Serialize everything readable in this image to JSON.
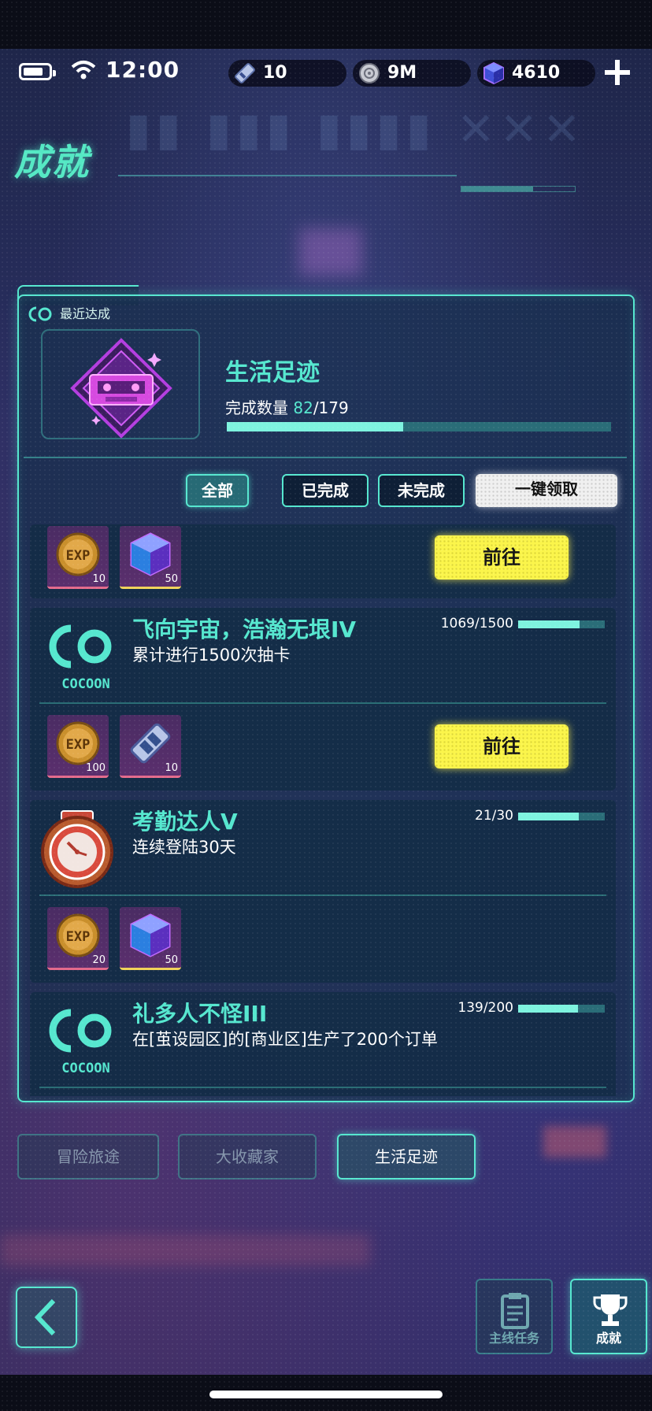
{
  "status": {
    "time": "12:00"
  },
  "resources": {
    "tickets": "10",
    "coins": "9M",
    "gems": "4610"
  },
  "page": {
    "title": "成就"
  },
  "recent": {
    "header": "最近达成",
    "name": "生活足迹",
    "count_label": "完成数量",
    "count_done": "82",
    "count_total": "/179",
    "progress": 0.458
  },
  "filters": {
    "all": "全部",
    "done": "已完成",
    "undone": "未完成",
    "claim_all": "一键领取"
  },
  "items": [
    {
      "rewards": [
        {
          "type": "exp",
          "qty": "10"
        },
        {
          "type": "gem",
          "qty": "50"
        }
      ],
      "action": "前往"
    },
    {
      "title": "飞向宇宙，浩瀚无垠IV",
      "desc": "累计进行1500次抽卡",
      "progress_text": "1069/1500",
      "progress": 0.71,
      "rewards": [
        {
          "type": "exp",
          "qty": "100"
        },
        {
          "type": "ticket",
          "qty": "10"
        }
      ],
      "action": "前往",
      "icon_label": "COCOON"
    },
    {
      "title": "考勤达人V",
      "desc": "连续登陆30天",
      "progress_text": "21/30",
      "progress": 0.7,
      "rewards": [
        {
          "type": "exp",
          "qty": "20"
        },
        {
          "type": "gem",
          "qty": "50"
        }
      ]
    },
    {
      "title": "礼多人不怪III",
      "desc": "在[茧设园区]的[商业区]生产了200个订单",
      "progress_text": "139/200",
      "progress": 0.695,
      "icon_label": "COCOON"
    }
  ],
  "categories": [
    "冒险旅途",
    "大收藏家",
    "生活足迹"
  ],
  "nav": {
    "main_task": "主线任务",
    "achievement": "成就"
  },
  "colors": {
    "accent": "#56e7cf",
    "go_button": "#fbf54b",
    "panel": "#18304e"
  }
}
